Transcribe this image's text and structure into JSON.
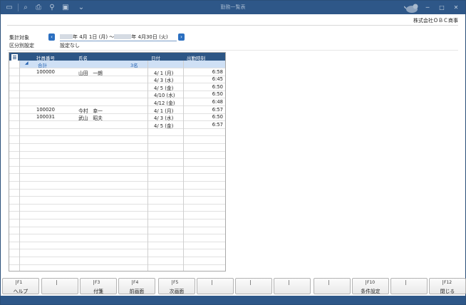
{
  "window": {
    "title": "勤務一覧表",
    "company": "株式会社ＯＢＣ商事"
  },
  "filters": {
    "period_label": "集計対象",
    "period_from": "年 4月 1日 (月) ～",
    "period_to": "年 4月30日 (火)",
    "section_label": "区分別設定",
    "section_value": "設定なし"
  },
  "grid": {
    "columns": [
      "社員番号",
      "氏名",
      "日付",
      "出勤時刻"
    ],
    "total": {
      "label": "合計",
      "count": "3名"
    },
    "rows": [
      {
        "emp_no": "100000",
        "name": "山田　一朗",
        "date": "4/ 1 (月)",
        "time": "6:58"
      },
      {
        "emp_no": "",
        "name": "",
        "date": "4/ 3 (水)",
        "time": "6:45"
      },
      {
        "emp_no": "",
        "name": "",
        "date": "4/ 5 (金)",
        "time": "6:50"
      },
      {
        "emp_no": "",
        "name": "",
        "date": "4/10 (水)",
        "time": "6:50"
      },
      {
        "emp_no": "",
        "name": "",
        "date": "4/12 (金)",
        "time": "6:48"
      },
      {
        "emp_no": "100020",
        "name": "今村　幸一",
        "date": "4/ 1 (月)",
        "time": "6:57"
      },
      {
        "emp_no": "100031",
        "name": "武山　昭夫",
        "date": "4/ 3 (水)",
        "time": "6:50"
      },
      {
        "emp_no": "",
        "name": "",
        "date": "4/ 5 (金)",
        "time": "6:57"
      }
    ]
  },
  "fkeys": [
    {
      "key": "F1",
      "label": "ヘルプ"
    },
    {
      "key": "",
      "label": ""
    },
    {
      "key": "F3",
      "label": "付箋"
    },
    {
      "key": "F4",
      "label": "前画面"
    },
    {
      "key": "F5",
      "label": "次画面"
    },
    {
      "key": "",
      "label": ""
    },
    {
      "key": "",
      "label": ""
    },
    {
      "key": "",
      "label": ""
    },
    {
      "key": "",
      "label": ""
    },
    {
      "key": "F10",
      "label": "条件設定"
    },
    {
      "key": "",
      "label": ""
    },
    {
      "key": "F12",
      "label": "閉じる"
    }
  ],
  "icons": [
    "window-icon",
    "search-icon",
    "print-icon",
    "chart-icon",
    "export-icon",
    "dropdown-icon",
    "mascot-icon",
    "minimize-icon",
    "maximize-icon",
    "close-icon",
    "prev-period-icon",
    "next-period-icon",
    "grid-menu-icon",
    "collapse-icon"
  ],
  "colors": {
    "titlebar": "#2e5788",
    "header": "#2d5685",
    "total_row": "#cfe0f5",
    "accent": "#2b6fc0"
  }
}
